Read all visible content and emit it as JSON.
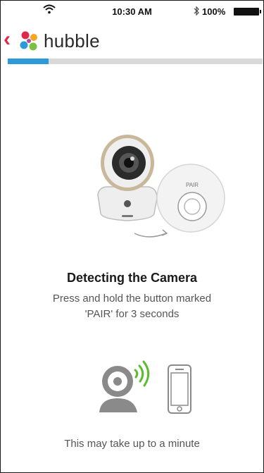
{
  "status_bar": {
    "time": "10:30 AM",
    "battery_percent": "100%",
    "wifi_icon": "wifi-icon",
    "bluetooth_icon": "bluetooth-icon"
  },
  "header": {
    "back_icon": "chevron-left-icon",
    "brand": "hubble",
    "logo_colors": [
      "#e0284a",
      "#f5a623",
      "#2c9ad9",
      "#7bc043"
    ]
  },
  "progress": {
    "value": 0.16,
    "color": "#2c9ad9"
  },
  "illustration": {
    "pair_label": "PAIR"
  },
  "main": {
    "title": "Detecting the Camera",
    "instruction_line1": "Press and hold the button marked",
    "instruction_line2": "'PAIR' for 3 seconds"
  },
  "pairing_graphic": {
    "signal_color": "#5bbd2e"
  },
  "footer": {
    "note": "This may take up to a minute"
  }
}
